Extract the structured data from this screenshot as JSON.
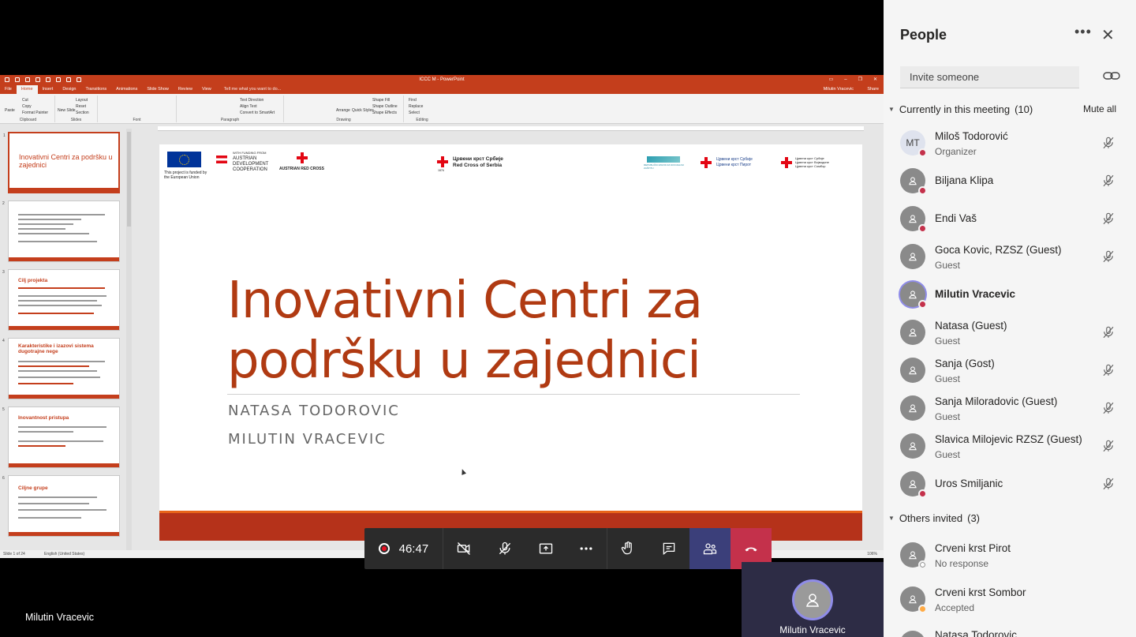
{
  "ppt": {
    "window_title": "ICCC M - PowerPoint",
    "tabs": [
      "File",
      "Home",
      "Insert",
      "Design",
      "Transitions",
      "Animations",
      "Slide Show",
      "Review",
      "View"
    ],
    "tell_me": "Tell me what you want to do...",
    "user": "Milutin Vracevic",
    "share": "Share",
    "ribbon": {
      "clipboard": {
        "label": "Clipboard",
        "paste": "Paste",
        "cut": "Cut",
        "copy": "Copy",
        "format_painter": "Format Painter"
      },
      "slides": {
        "label": "Slides",
        "new_slide": "New Slide",
        "layout": "Layout",
        "reset": "Reset",
        "section": "Section"
      },
      "font": {
        "label": "Font"
      },
      "paragraph": {
        "label": "Paragraph",
        "text_direction": "Text Direction",
        "align_text": "Align Text",
        "convert_smartart": "Convert to SmartArt"
      },
      "drawing": {
        "label": "Drawing",
        "arrange": "Arrange",
        "quick_styles": "Quick Styles",
        "shape_fill": "Shape Fill",
        "shape_outline": "Shape Outline",
        "shape_effects": "Shape Effects"
      },
      "editing": {
        "label": "Editing",
        "find": "Find",
        "replace": "Replace",
        "select": "Select"
      }
    },
    "thumbnails": [
      {
        "num": "1",
        "title": "Inovativni Centri za podršku u zajednici"
      },
      {
        "num": "2",
        "title": ""
      },
      {
        "num": "3",
        "title": "Cilj projekta"
      },
      {
        "num": "4",
        "title": "Karakteristike i izazovi sistema dugotrajne nege"
      },
      {
        "num": "5",
        "title": "Inovantnost pristupa"
      },
      {
        "num": "6",
        "title": "Ciljne grupe"
      }
    ],
    "slide": {
      "eu_text": "This project is funded by the European Union",
      "ada_small": "WITH FUNDING FROM",
      "ada_text": "AUSTRIAN DEVELOPMENT COOPERATION",
      "arc_text": "AUSTRIAN RED CROSS",
      "rcs_cyr": "Црвени крст Србије",
      "rcs_lat": "Red Cross of Serbia",
      "rcs_year": "1876",
      "rz_text": "REPUBLIČKI ZAVOD ZA SOCIJALNU ZAŠTITU",
      "pirot_1": "Црвени крст Србије",
      "pirot_2": "Црвени крст Пирот",
      "sombor_1": "Црвени крст Србије",
      "sombor_2": "Црвени крст Војводине",
      "sombor_3": "Црвени крст Сомбор",
      "title_line1": "Inovativni Centri za",
      "title_line2": "podršku u zajednici",
      "author1": "NATASA TODOROVIC",
      "author2": "MILUTIN VRACEVIC"
    },
    "status_slide": "Slide 1 of 24",
    "status_lang": "English (United States)",
    "zoom": "106%"
  },
  "meeting": {
    "timer": "46:47",
    "presenter_name": "Milutin Vracevic",
    "self_name": "Milutin Vracevic",
    "buttons": {
      "camera": "camera-off-icon",
      "mic": "mic-off-icon",
      "share": "share-screen-icon",
      "more": "more-icon",
      "raise_hand": "raise-hand-icon",
      "chat": "chat-icon",
      "participants": "participants-icon",
      "hangup": "hang-up-icon"
    },
    "colors": {
      "hangup": "#c4314b",
      "participants_active": "#3b3f7a",
      "recording": "#e81123"
    }
  },
  "people_panel": {
    "title": "People",
    "invite_placeholder": "Invite someone",
    "currently_label": "Currently in this meeting",
    "currently_count": "(10)",
    "mute_all": "Mute all",
    "participants": [
      {
        "name": "Miloš Todorović",
        "role": "Organizer",
        "initials": "MT",
        "muted": true
      },
      {
        "name": "Biljana Klipa",
        "role": "",
        "muted": true
      },
      {
        "name": "Endi Vaš",
        "role": "",
        "muted": true
      },
      {
        "name": "Goca Kovic, RZSZ (Guest)",
        "role": "Guest",
        "muted": true
      },
      {
        "name": "Milutin Vracevic",
        "role": "",
        "muted": false
      },
      {
        "name": "Natasa (Guest)",
        "role": "Guest",
        "muted": true
      },
      {
        "name": "Sanja (Gost)",
        "role": "Guest",
        "muted": true
      },
      {
        "name": "Sanja Miloradovic (Guest)",
        "role": "Guest",
        "muted": true
      },
      {
        "name": "Slavica Milojevic RZSZ (Guest)",
        "role": "Guest",
        "muted": true
      },
      {
        "name": "Uros Smiljanic",
        "role": "",
        "muted": true
      }
    ],
    "others_label": "Others invited",
    "others_count": "(3)",
    "invited": [
      {
        "name": "Crveni krst Pirot",
        "status": "No response"
      },
      {
        "name": "Crveni krst Sombor",
        "status": "Accepted"
      },
      {
        "name": "Natasa Todorovic",
        "status": ""
      }
    ]
  }
}
